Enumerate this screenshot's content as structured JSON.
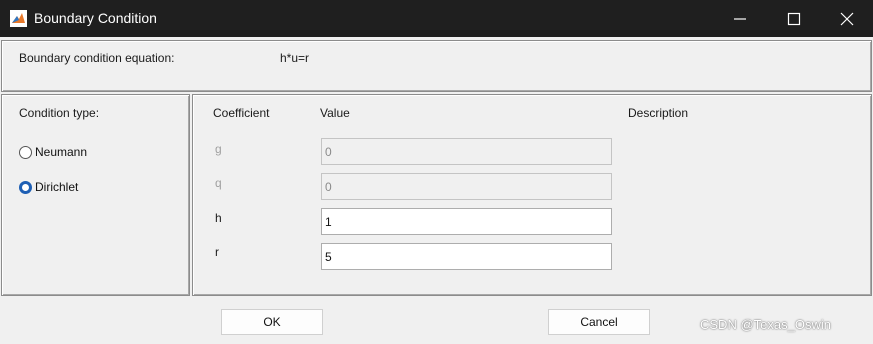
{
  "window": {
    "title": "Boundary Condition"
  },
  "equation": {
    "label": "Boundary condition equation:",
    "value": "h*u=r"
  },
  "condition_type": {
    "label": "Condition type:",
    "options": [
      {
        "label": "Neumann",
        "selected": false
      },
      {
        "label": "Dirichlet",
        "selected": true
      }
    ]
  },
  "coefficients": {
    "headers": {
      "coefficient": "Coefficient",
      "value": "Value",
      "description": "Description"
    },
    "rows": [
      {
        "name": "g",
        "value": "0",
        "enabled": false
      },
      {
        "name": "q",
        "value": "0",
        "enabled": false
      },
      {
        "name": "h",
        "value": "1",
        "enabled": true
      },
      {
        "name": "r",
        "value": "5",
        "enabled": true
      }
    ]
  },
  "buttons": {
    "ok": "OK",
    "cancel": "Cancel"
  },
  "watermark": "CSDN @Texas_Oswin",
  "colors": {
    "titlebar": "#1f1f1f",
    "radio_selected": "#1e5fb4"
  }
}
